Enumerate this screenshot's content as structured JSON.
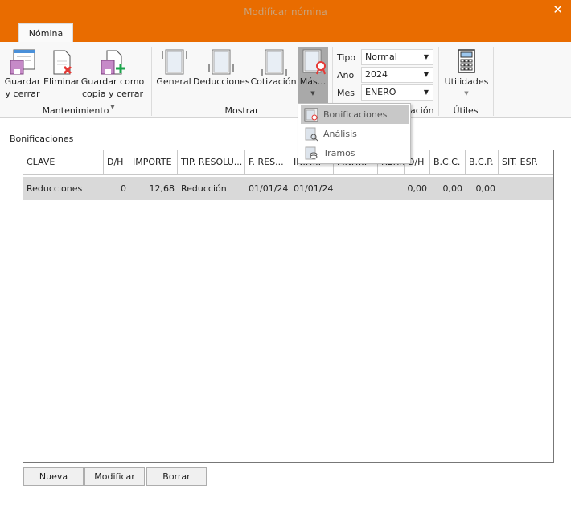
{
  "window": {
    "title": "Modificar nómina",
    "close": "✕"
  },
  "tabs": [
    {
      "label": "Nómina",
      "active": true
    }
  ],
  "ribbon": {
    "mantenimiento": {
      "label": "Mantenimiento",
      "guardar_l1": "Guardar",
      "guardar_l2": "y cerrar",
      "eliminar": "Eliminar",
      "copia_l1": "Guardar como",
      "copia_l2": "copia y cerrar"
    },
    "mostrar": {
      "label": "Mostrar",
      "general": "General",
      "deducciones": "Deducciones",
      "cotizacion": "Cotización",
      "mas": "Más..."
    },
    "liquidacion": {
      "label_visible": "ación",
      "tipo_label": "Tipo",
      "tipo": "Normal",
      "anio_label": "Año",
      "anio": "2024",
      "mes_label": "Mes",
      "mes": "ENERO"
    },
    "utiles": {
      "label": "Útiles",
      "utilidades": "Utilidades"
    }
  },
  "menu": {
    "items": [
      {
        "label": "Bonificaciones",
        "selected": true
      },
      {
        "label": "Análisis"
      },
      {
        "label": "Tramos"
      }
    ]
  },
  "section": {
    "title": "Bonificaciones"
  },
  "table": {
    "columns": [
      "CLAVE",
      "D/H",
      "IMPORTE",
      "TIP. RESOLU...",
      "F. RES...",
      "INI.T...",
      "FIN.T...",
      "REF...",
      "D/H",
      "B.C.C.",
      "B.C.P.",
      "SIT. ESP."
    ],
    "rows": [
      [
        "Reducciones",
        "0",
        "12,68",
        "Reducción",
        "01/01/24",
        "01/01/24",
        "",
        "",
        "0,00",
        "0,00",
        "0,00",
        ""
      ]
    ]
  },
  "buttons": {
    "nueva": "Nueva",
    "modificar": "Modificar",
    "borrar": "Borrar"
  },
  "colors": {
    "accent": "#E96C00",
    "row_selected": "#d9d9d9"
  }
}
